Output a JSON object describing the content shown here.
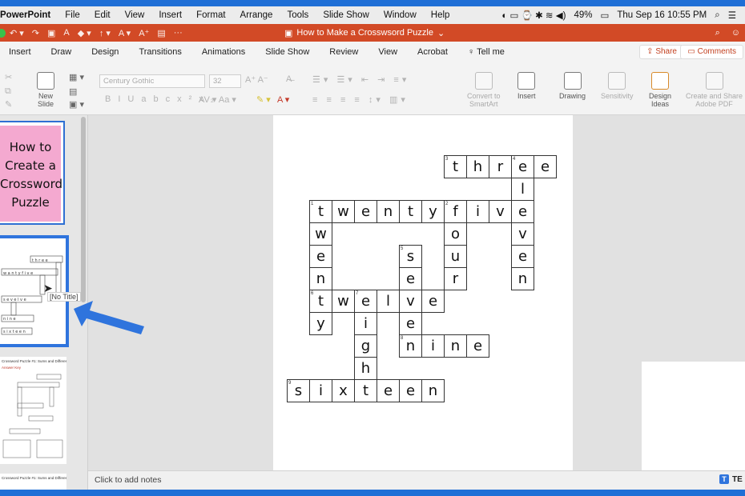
{
  "menubar": {
    "app": "PowerPoint",
    "items": [
      "File",
      "Edit",
      "View",
      "Insert",
      "Format",
      "Arrange",
      "Tools",
      "Slide Show",
      "Window",
      "Help"
    ],
    "battery": "49%",
    "datetime": "Thu Sep 16  10:55 PM"
  },
  "titlebar": {
    "document": "How to Make a Crosswsord Puzzle",
    "color": "#d24a26"
  },
  "tabs": [
    "Insert",
    "Draw",
    "Design",
    "Transitions",
    "Animations",
    "Slide Show",
    "Review",
    "View",
    "Acrobat",
    "Tell me"
  ],
  "share_label": "Share",
  "comments_label": "Comments",
  "ribbon": {
    "new_slide": "New\nSlide",
    "font": "Century Gothic",
    "size": "32",
    "convert": "Convert to\nSmartArt",
    "insert": "Insert",
    "drawing": "Drawing",
    "sensitivity": "Sensitivity",
    "design_ideas": "Design\nIdeas",
    "create_share": "Create and Share\nAdobe PDF"
  },
  "thumb1_text": "How to\nCreate a\nCrossword\nPuzzle",
  "thumb3_header": "Crossword Puzzle #1: Sums and Differences",
  "thumb3_sub": "Answer Key",
  "thumb4_header": "Crossword Puzzle #1: Sums and Differences",
  "tooltip": "[No Title]",
  "notes": "Click to add notes",
  "logo": "TE",
  "crossword": {
    "cells": [
      {
        "r": 0,
        "c": 7,
        "ch": "t",
        "n": "3"
      },
      {
        "r": 0,
        "c": 8,
        "ch": "h"
      },
      {
        "r": 0,
        "c": 9,
        "ch": "r"
      },
      {
        "r": 0,
        "c": 10,
        "ch": "e",
        "n": "4"
      },
      {
        "r": 0,
        "c": 11,
        "ch": "e"
      },
      {
        "r": 1,
        "c": 10,
        "ch": "l"
      },
      {
        "r": 2,
        "c": 1,
        "ch": "t",
        "n": "1"
      },
      {
        "r": 2,
        "c": 2,
        "ch": "w"
      },
      {
        "r": 2,
        "c": 3,
        "ch": "e"
      },
      {
        "r": 2,
        "c": 4,
        "ch": "n"
      },
      {
        "r": 2,
        "c": 5,
        "ch": "t"
      },
      {
        "r": 2,
        "c": 6,
        "ch": "y"
      },
      {
        "r": 2,
        "c": 7,
        "ch": "f",
        "n": "2"
      },
      {
        "r": 2,
        "c": 8,
        "ch": "i"
      },
      {
        "r": 2,
        "c": 9,
        "ch": "v"
      },
      {
        "r": 2,
        "c": 10,
        "ch": "e"
      },
      {
        "r": 3,
        "c": 1,
        "ch": "w"
      },
      {
        "r": 3,
        "c": 7,
        "ch": "o"
      },
      {
        "r": 3,
        "c": 10,
        "ch": "v"
      },
      {
        "r": 4,
        "c": 1,
        "ch": "e"
      },
      {
        "r": 4,
        "c": 5,
        "ch": "s",
        "n": "5"
      },
      {
        "r": 4,
        "c": 7,
        "ch": "u"
      },
      {
        "r": 4,
        "c": 10,
        "ch": "e"
      },
      {
        "r": 5,
        "c": 1,
        "ch": "n"
      },
      {
        "r": 5,
        "c": 5,
        "ch": "e"
      },
      {
        "r": 5,
        "c": 7,
        "ch": "r"
      },
      {
        "r": 5,
        "c": 10,
        "ch": "n"
      },
      {
        "r": 6,
        "c": 1,
        "ch": "t",
        "n": "6"
      },
      {
        "r": 6,
        "c": 2,
        "ch": "w"
      },
      {
        "r": 6,
        "c": 3,
        "ch": "e",
        "n": "7"
      },
      {
        "r": 6,
        "c": 4,
        "ch": "l"
      },
      {
        "r": 6,
        "c": 5,
        "ch": "v"
      },
      {
        "r": 6,
        "c": 6,
        "ch": "e"
      },
      {
        "r": 7,
        "c": 1,
        "ch": "y"
      },
      {
        "r": 7,
        "c": 3,
        "ch": "i"
      },
      {
        "r": 7,
        "c": 5,
        "ch": "e"
      },
      {
        "r": 8,
        "c": 3,
        "ch": "g"
      },
      {
        "r": 8,
        "c": 5,
        "ch": "n",
        "n": "8"
      },
      {
        "r": 8,
        "c": 6,
        "ch": "i"
      },
      {
        "r": 8,
        "c": 7,
        "ch": "n"
      },
      {
        "r": 8,
        "c": 8,
        "ch": "e"
      },
      {
        "r": 9,
        "c": 3,
        "ch": "h"
      },
      {
        "r": 10,
        "c": 0,
        "ch": "s",
        "n": "9"
      },
      {
        "r": 10,
        "c": 1,
        "ch": "i"
      },
      {
        "r": 10,
        "c": 2,
        "ch": "x"
      },
      {
        "r": 10,
        "c": 3,
        "ch": "t"
      },
      {
        "r": 10,
        "c": 4,
        "ch": "e"
      },
      {
        "r": 10,
        "c": 5,
        "ch": "e"
      },
      {
        "r": 10,
        "c": 6,
        "ch": "n"
      }
    ]
  }
}
